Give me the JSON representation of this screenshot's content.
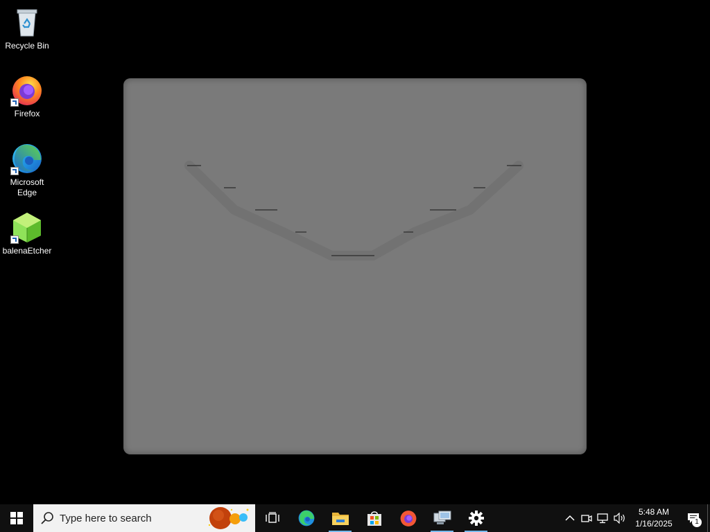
{
  "desktop": {
    "icons": [
      {
        "label": "Recycle Bin",
        "icon": "recycle-bin-icon"
      },
      {
        "label": "Firefox",
        "icon": "firefox-icon"
      },
      {
        "label": "Microsoft Edge",
        "icon": "edge-icon"
      },
      {
        "label": "balenaEtcher",
        "icon": "balena-etcher-icon"
      }
    ]
  },
  "taskbar": {
    "search_placeholder": "Type here to search",
    "pinned": [
      {
        "name": "task-view",
        "icon": "task-view-icon"
      },
      {
        "name": "edge",
        "icon": "edge-icon"
      },
      {
        "name": "file-explorer",
        "icon": "folder-icon",
        "active": true
      },
      {
        "name": "microsoft-store",
        "icon": "store-icon"
      },
      {
        "name": "firefox",
        "icon": "firefox-icon"
      },
      {
        "name": "remote-desktop",
        "icon": "remote-desktop-icon",
        "active": true
      },
      {
        "name": "settings",
        "icon": "gear-icon",
        "active": true
      }
    ],
    "clock": {
      "time": "5:48 AM",
      "date": "1/16/2025"
    },
    "notification_count": "1"
  },
  "colors": {
    "desktop_bg": "#000000",
    "taskbar_bg": "#101010",
    "window_bg": "#7a7a7a",
    "accent_underline": "#76b9ed"
  }
}
